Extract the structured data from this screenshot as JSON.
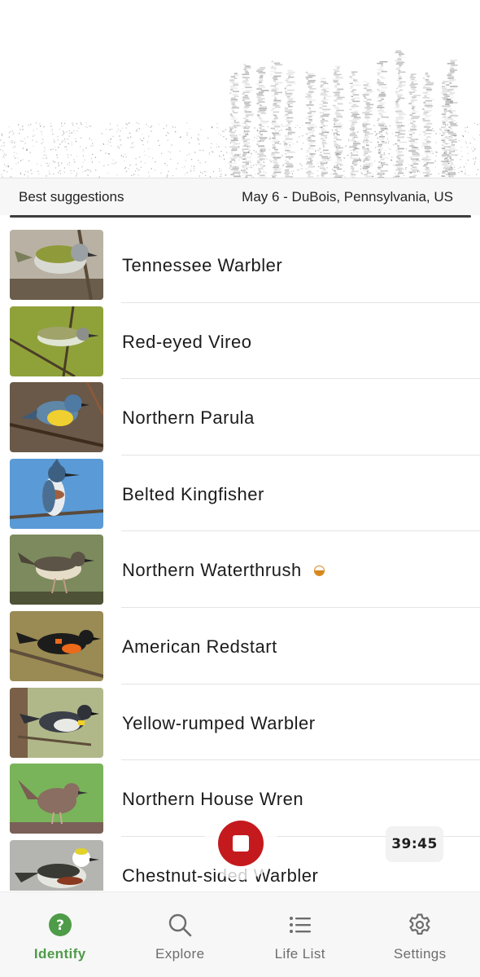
{
  "header": {
    "section_label": "Best suggestions",
    "recording_info": "May 6 - DuBois, Pennsylvania, US"
  },
  "species": [
    {
      "name": "Tennessee Warbler",
      "photo_icon": "tennessee-warbler-photo",
      "badge": false
    },
    {
      "name": "Red-eyed Vireo",
      "photo_icon": "red-eyed-vireo-photo",
      "badge": false
    },
    {
      "name": "Northern Parula",
      "photo_icon": "northern-parula-photo",
      "badge": false
    },
    {
      "name": "Belted Kingfisher",
      "photo_icon": "belted-kingfisher-photo",
      "badge": false
    },
    {
      "name": "Northern Waterthrush",
      "photo_icon": "northern-waterthrush-photo",
      "badge": true
    },
    {
      "name": "American Redstart",
      "photo_icon": "american-redstart-photo",
      "badge": false
    },
    {
      "name": "Yellow-rumped Warbler",
      "photo_icon": "yellow-rumped-warbler-photo",
      "badge": false
    },
    {
      "name": "Northern House Wren",
      "photo_icon": "northern-house-wren-photo",
      "badge": false
    },
    {
      "name": "Chestnut-sided Warbler",
      "photo_icon": "chestnut-sided-warbler-photo",
      "badge": false
    }
  ],
  "timer": "39:45",
  "record_icon": "stop-recording-icon",
  "nav": [
    {
      "label": "Identify",
      "icon": "question-circle-icon",
      "active": true
    },
    {
      "label": "Explore",
      "icon": "search-icon",
      "active": false
    },
    {
      "label": "Life List",
      "icon": "list-icon",
      "active": false
    },
    {
      "label": "Settings",
      "icon": "gear-icon",
      "active": false
    }
  ],
  "colors": {
    "accent_green": "#4e9b48",
    "record_red": "#c41a1d",
    "badge_orange": "#d7861a"
  }
}
